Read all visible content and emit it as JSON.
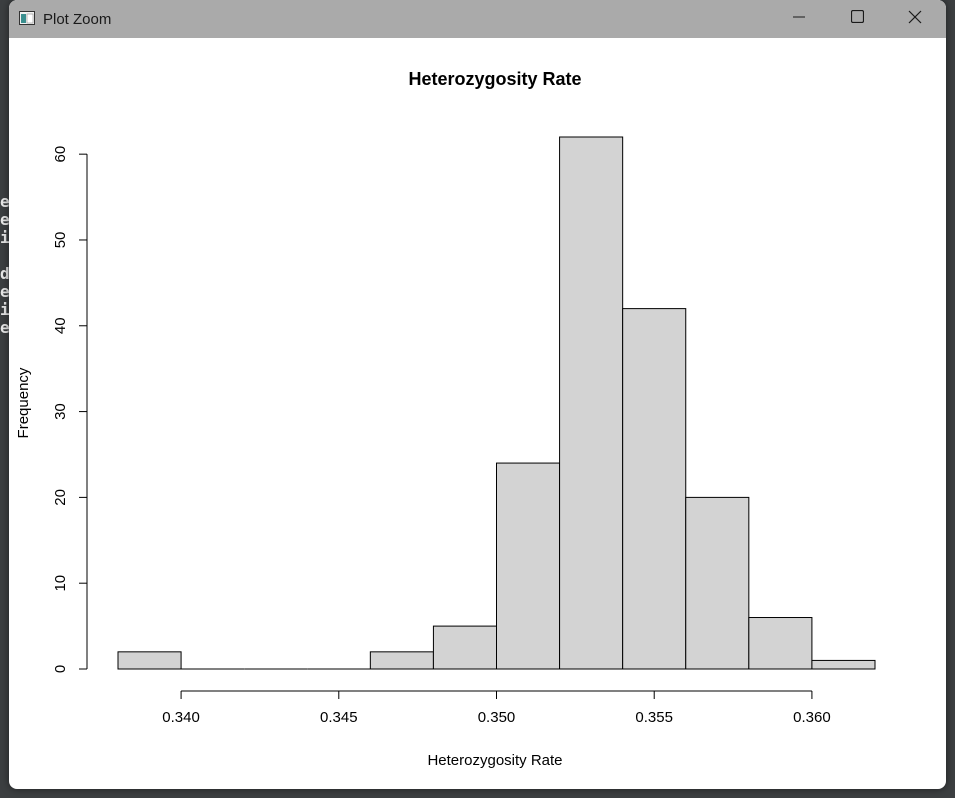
{
  "window": {
    "title": "Plot Zoom"
  },
  "chart_data": {
    "type": "bar",
    "title": "Heterozygosity Rate",
    "xlabel": "Heterozygosity Rate",
    "ylabel": "Frequency",
    "bins": [
      {
        "start": 0.338,
        "end": 0.34,
        "count": 2
      },
      {
        "start": 0.34,
        "end": 0.342,
        "count": 0
      },
      {
        "start": 0.342,
        "end": 0.344,
        "count": 0
      },
      {
        "start": 0.344,
        "end": 0.346,
        "count": 0
      },
      {
        "start": 0.346,
        "end": 0.348,
        "count": 2
      },
      {
        "start": 0.348,
        "end": 0.35,
        "count": 5
      },
      {
        "start": 0.35,
        "end": 0.352,
        "count": 24
      },
      {
        "start": 0.352,
        "end": 0.354,
        "count": 62
      },
      {
        "start": 0.354,
        "end": 0.356,
        "count": 42
      },
      {
        "start": 0.356,
        "end": 0.358,
        "count": 20
      },
      {
        "start": 0.358,
        "end": 0.36,
        "count": 6
      },
      {
        "start": 0.36,
        "end": 0.362,
        "count": 1
      }
    ],
    "xlim": [
      0.338,
      0.362
    ],
    "ylim": [
      0,
      62
    ],
    "x_ticks": [
      0.34,
      0.345,
      0.35,
      0.355,
      0.36
    ],
    "x_tick_labels": [
      "0.340",
      "0.345",
      "0.350",
      "0.355",
      "0.360"
    ],
    "y_ticks": [
      0,
      10,
      20,
      30,
      40,
      50,
      60
    ],
    "y_tick_labels": [
      "0",
      "10",
      "20",
      "30",
      "40",
      "50",
      "60"
    ],
    "bar_fill": "#d3d3d3",
    "bar_stroke": "#000000",
    "grid": false
  }
}
